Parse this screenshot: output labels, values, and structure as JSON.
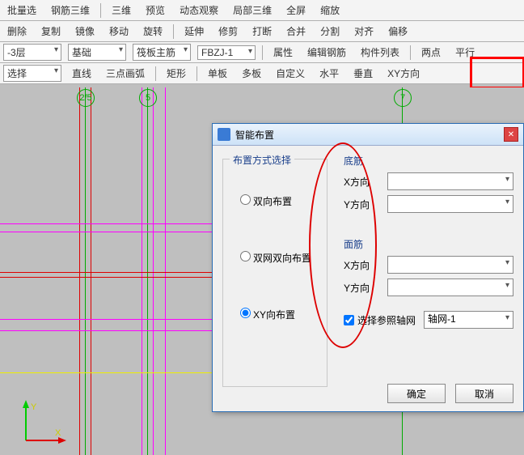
{
  "tb1": {
    "i1": "批量选",
    "i2": "钢筋三维",
    "i3": "三维",
    "i4": "预览",
    "i5": "动态观察",
    "i6": "局部三维",
    "i7": "全屏",
    "i8": "缩放"
  },
  "tb2": {
    "del": "删除",
    "copy": "复制",
    "mirror": "镜像",
    "move": "移动",
    "rotate": "旋转",
    "extend": "延伸",
    "trim": "修剪",
    "break": "打断",
    "merge": "合并",
    "split": "分割",
    "align": "对齐",
    "offset": "偏移"
  },
  "tb3": {
    "layer": "-3层",
    "base": "基础",
    "type": "筏板主筋",
    "code": "FBZJ-1",
    "prop": "属性",
    "edit": "编辑钢筋",
    "list": "构件列表",
    "twopt": "两点",
    "parallel": "平行"
  },
  "tb4": {
    "select": "选择",
    "line": "直线",
    "arc": "三点画弧",
    "rect": "矩形",
    "single": "单板",
    "multi": "多板",
    "custom": "自定义",
    "horiz": "水平",
    "vert": "垂直",
    "xy": "XY方向"
  },
  "marks": {
    "a": "2/5",
    "b": "5",
    "c": "7",
    "ax": "X",
    "ay": "Y"
  },
  "dlg": {
    "title": "智能布置",
    "group": "布置方式选择",
    "opt1": "双向布置",
    "opt2": "双网双向布置",
    "opt3": "XY向布置",
    "bottom": "底筋",
    "top": "面筋",
    "xdir": "X方向",
    "ydir": "Y方向",
    "ref": "选择参照轴网",
    "grid": "轴网-1",
    "ok": "确定",
    "cancel": "取消"
  }
}
